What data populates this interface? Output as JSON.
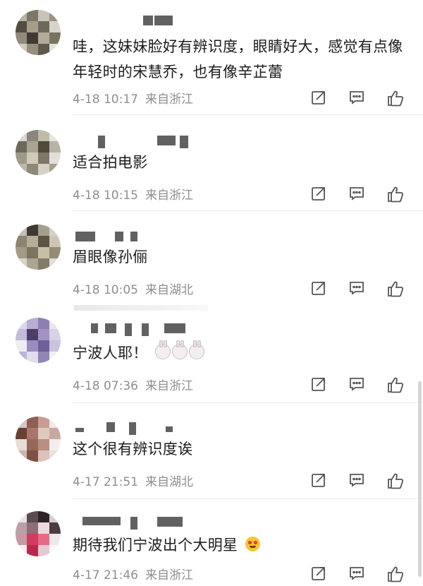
{
  "comments": [
    {
      "text": "哇，这妹妹脸好有辨识度，眼睛好大，感觉有点像年轻时的宋慧乔，也有像辛芷蕾",
      "time": "4-18 10:17",
      "location": "来自浙江"
    },
    {
      "text": "适合拍电影",
      "time": "4-18 10:15",
      "location": "来自浙江"
    },
    {
      "text": "眉眼像孙俪",
      "time": "4-18 10:05",
      "location": "来自湖北"
    },
    {
      "text": "宁波人耶！",
      "time": "4-18 07:36",
      "location": "来自浙江",
      "emoji": [
        "rabbit-face-icon",
        "rabbit-face-icon",
        "rabbit-face-icon"
      ]
    },
    {
      "text": "这个很有辨识度诶",
      "time": "4-17 21:51",
      "location": "来自湖北"
    },
    {
      "text": "期待我们宁波出个大明星",
      "time": "4-17 21:46",
      "location": "来自浙江",
      "emoji": [
        "heart-eyes-face-icon"
      ]
    }
  ],
  "icons": {
    "share": "share-icon",
    "comment": "comment-icon",
    "like": "like-icon"
  },
  "colors": {
    "text": "#1c1c1c",
    "meta": "#8e8e8e",
    "icon": "#555555"
  }
}
